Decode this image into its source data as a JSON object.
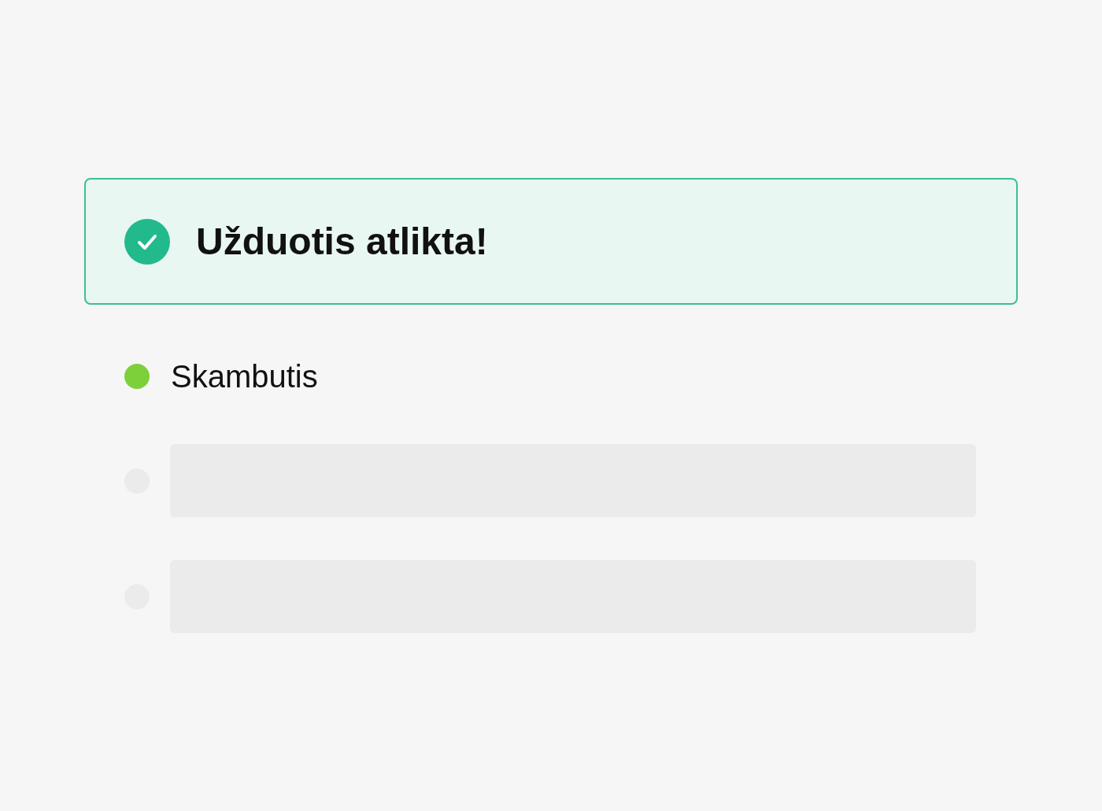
{
  "banner": {
    "kind": "success",
    "title": "Užduotis atlikta!"
  },
  "items": [
    {
      "kind": "text",
      "label": "Skambutis",
      "color": "#7ed03a"
    },
    {
      "kind": "skeleton",
      "color": "#ebebeb"
    },
    {
      "kind": "skeleton",
      "color": "#ebebeb"
    }
  ]
}
